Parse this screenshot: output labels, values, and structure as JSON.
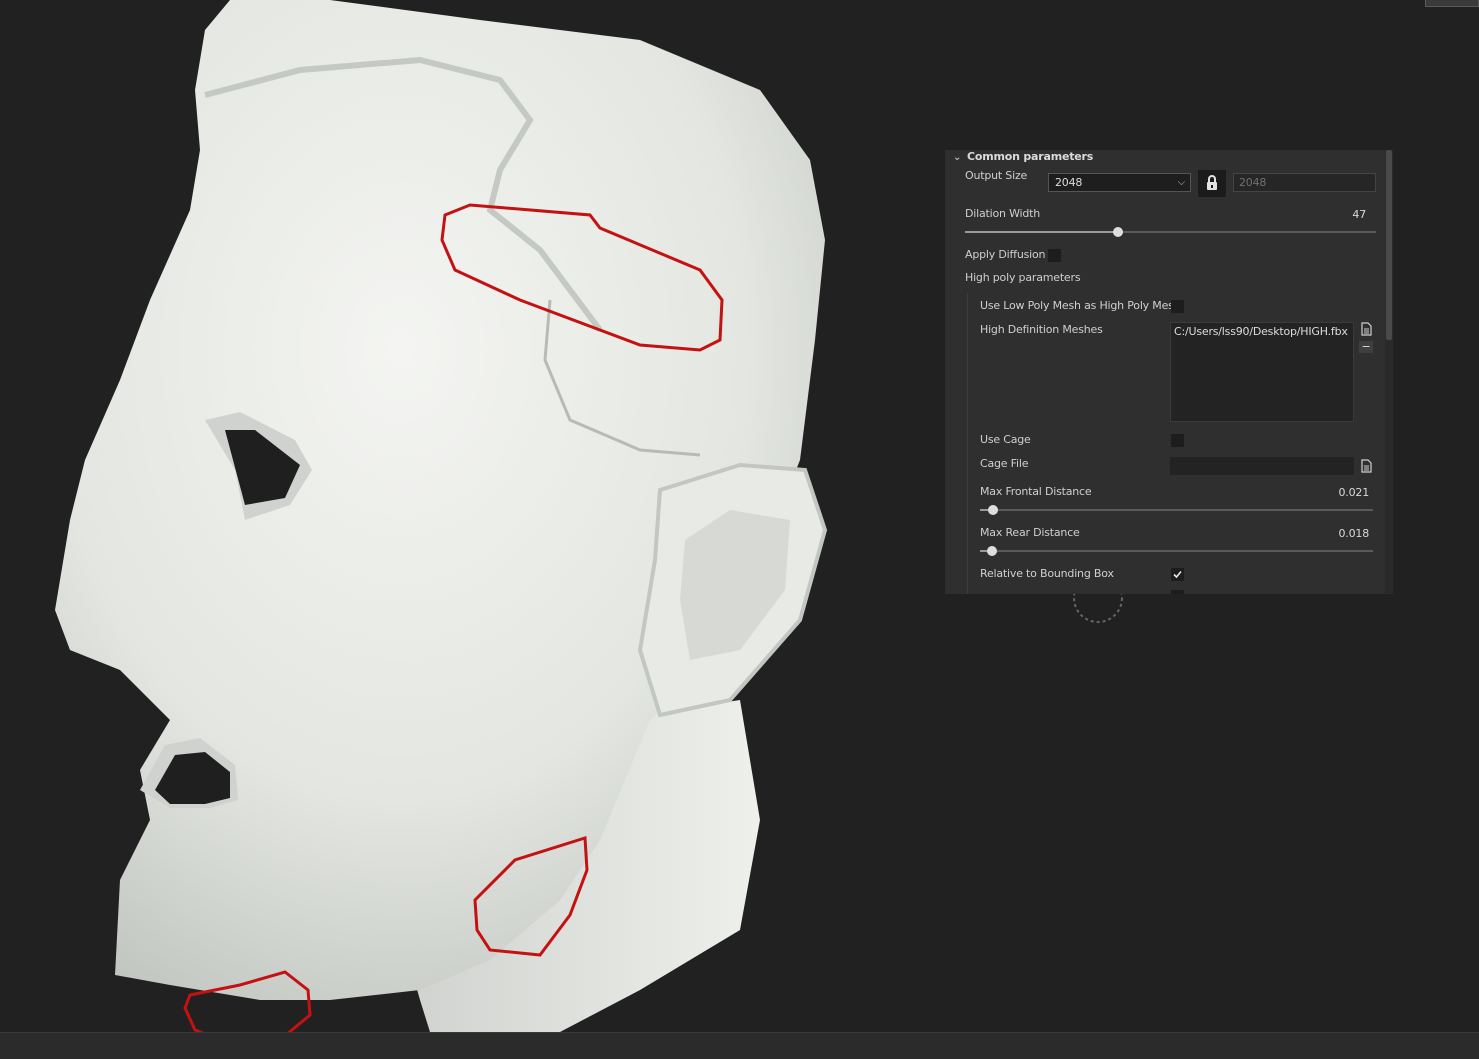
{
  "panel": {
    "section_title": "Common parameters",
    "output_size": {
      "label": "Output Size",
      "value": "2048",
      "linked_value": "2048"
    },
    "dilation_width": {
      "label": "Dilation Width",
      "value": "47",
      "fraction": 0.37
    },
    "apply_diffusion": {
      "label": "Apply Diffusion",
      "checked": false
    },
    "high_poly_parameters": {
      "label": "High poly parameters"
    },
    "use_low_poly": {
      "label": "Use Low Poly Mesh as High Poly Mesh",
      "checked": false
    },
    "high_definition_meshes": {
      "label": "High Definition Meshes",
      "items": [
        "C:/Users/lss90/Desktop/HIGH.fbx"
      ]
    },
    "use_cage": {
      "label": "Use Cage",
      "checked": false
    },
    "cage_file": {
      "label": "Cage File",
      "value": ""
    },
    "max_frontal_distance": {
      "label": "Max Frontal Distance",
      "value": "0.021",
      "fraction": 0.03
    },
    "max_rear_distance": {
      "label": "Max Rear Distance",
      "value": "0.018",
      "fraction": 0.03
    },
    "relative_to_bounding_box": {
      "label": "Relative to Bounding Box",
      "checked": true
    }
  },
  "icons": {
    "section_chevron": "chevron-down-icon",
    "lock": "lock-icon",
    "file": "file-icon",
    "remove": "minus-icon",
    "check": "checkmark-icon"
  },
  "colors": {
    "viewport_bg": "#212121",
    "panel_bg": "#2f2f2f",
    "model_surface": "#e6e8e4",
    "annotation": "#c41212"
  }
}
